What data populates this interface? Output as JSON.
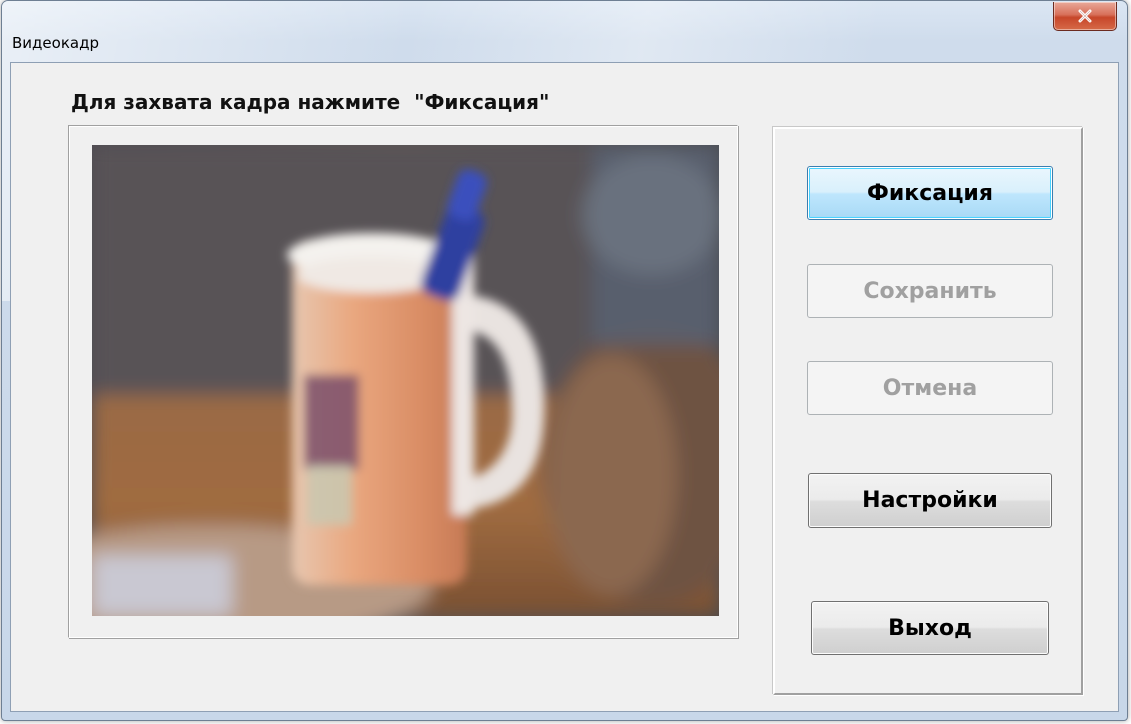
{
  "window": {
    "title": "Видеокадр"
  },
  "dialog": {
    "instruction": "Для захвата кадра нажмите  \"Фиксация\""
  },
  "buttons": {
    "capture_label": "Фиксация",
    "save_label": "Сохранить",
    "cancel_label": "Отмена",
    "settings_label": "Настройки",
    "exit_label": "Выход"
  },
  "states": {
    "capture": "default",
    "save": "disabled",
    "cancel": "disabled",
    "settings": "enabled",
    "exit": "enabled"
  },
  "icons": {
    "close": "close-icon"
  },
  "colors": {
    "close_button": "#c7462a",
    "default_button_border": "#3c7fb1",
    "disabled_text": "#a0a0a0",
    "dialog_background": "#f0f0f0"
  }
}
